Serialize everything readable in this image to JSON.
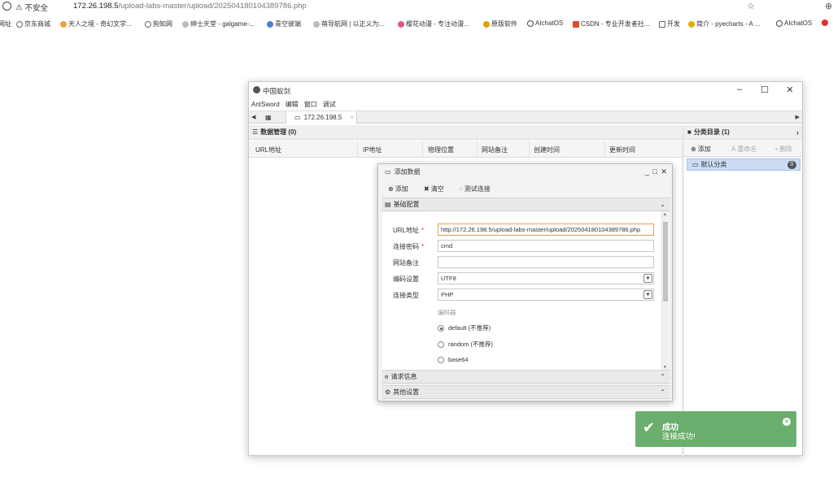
{
  "browser": {
    "security_label": "不安全",
    "url_host": "172.26.198.5",
    "url_path": "/upload-labs-master/upload/202504180104389786.php",
    "bookmarks": [
      {
        "label": "网址",
        "color": "#888888"
      },
      {
        "label": "京东商城",
        "color": "#888888"
      },
      {
        "label": "天人之境 - 奇幻文学...",
        "color": "#f0a040"
      },
      {
        "label": "狗知网",
        "color": "#888888"
      },
      {
        "label": "绅士天堂 - galgame-...",
        "color": "#aaaaaa"
      },
      {
        "label": "青空彼端",
        "color": "#4a7fd0"
      },
      {
        "label": "萌导航网 | 以正义为...",
        "color": "#aaaaaa"
      },
      {
        "label": "樱花动漫 - 专注动漫...",
        "color": "#e05a7a"
      },
      {
        "label": "原版软件",
        "color": "#e0a000"
      },
      {
        "label": "AIchatOS",
        "color": "#444444"
      },
      {
        "label": "CSDN - 专业开发者社...",
        "color": "#e04b2b"
      },
      {
        "label": "开发",
        "color": "#888888"
      },
      {
        "label": "简介 - pyecharts - A ...",
        "color": "#e0b000"
      },
      {
        "label": "AIchatOS",
        "color": "#444444"
      }
    ]
  },
  "app": {
    "title": "中国蚁剑",
    "menu": [
      "AntSword",
      "编辑",
      "窗口",
      "调试"
    ],
    "tab_label": "172.26.198.5",
    "left_panel": {
      "title": "数据管理 (0)",
      "columns": [
        "URL地址",
        "IP地址",
        "物理位置",
        "网站备注",
        "创建时间",
        "更新时间"
      ]
    },
    "right_panel": {
      "title": "分类目录 (1)",
      "toolbar": {
        "add": "添加",
        "rename": "重命名",
        "delete": "删除"
      },
      "items": [
        {
          "label": "默认分类",
          "count": "0"
        }
      ]
    }
  },
  "dialog": {
    "title": "添加数据",
    "toolbar": {
      "add": "添加",
      "clear": "清空",
      "test": "测试连接"
    },
    "sections": {
      "basic": "基础配置",
      "request": "请求信息",
      "other": "其他设置"
    },
    "fields": {
      "url_label": "URL地址",
      "url_value": "http://172.26.198.5/upload-labs-master/upload/202504180104389786.php",
      "password_label": "连接密码",
      "password_value": "cmd",
      "note_label": "网站备注",
      "note_value": "",
      "encoding_label": "编码设置",
      "encoding_value": "UTF8",
      "type_label": "连接类型",
      "type_value": "PHP",
      "encoder_label": "编码器",
      "encoders": [
        {
          "label": "default (不推荐)",
          "selected": true
        },
        {
          "label": "random (不推荐)",
          "selected": false
        },
        {
          "label": "base64",
          "selected": false
        }
      ]
    }
  },
  "toast": {
    "title": "成功",
    "message": "连接成功!",
    "color": "#6aaf6d"
  }
}
